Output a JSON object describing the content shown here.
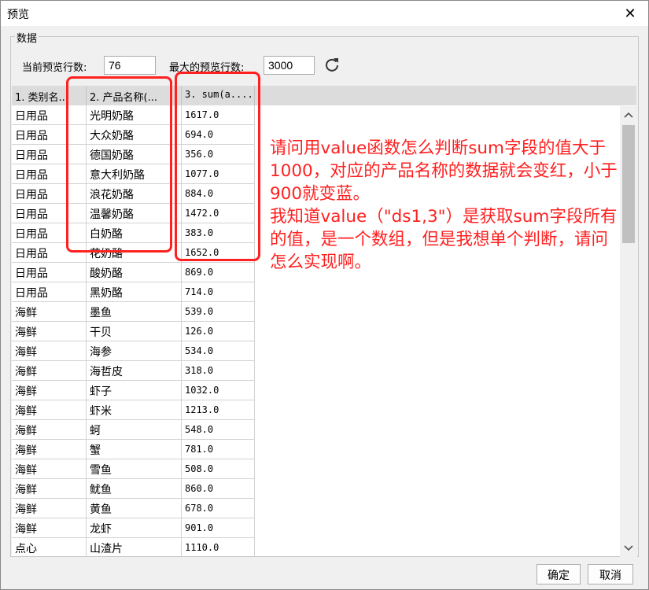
{
  "window": {
    "title": "预览",
    "close_label": "✕"
  },
  "group": {
    "legend": "数据"
  },
  "controls": {
    "current_rows_label": "当前预览行数:",
    "current_rows_value": "76",
    "max_rows_label": "最大的预览行数:",
    "max_rows_value": "3000",
    "refresh_icon": "refresh-icon"
  },
  "table": {
    "headers": [
      "1. 类别名...",
      "2. 产品名称(...",
      "3. sum(a...."
    ],
    "rows": [
      [
        "日用品",
        "光明奶酪",
        "1617.0"
      ],
      [
        "日用品",
        "大众奶酪",
        "694.0"
      ],
      [
        "日用品",
        "德国奶酪",
        "356.0"
      ],
      [
        "日用品",
        "意大利奶酪",
        "1077.0"
      ],
      [
        "日用品",
        "浪花奶酪",
        "884.0"
      ],
      [
        "日用品",
        "温馨奶酪",
        "1472.0"
      ],
      [
        "日用品",
        "白奶酪",
        "383.0"
      ],
      [
        "日用品",
        "花奶酪",
        "1652.0"
      ],
      [
        "日用品",
        "酸奶酪",
        "869.0"
      ],
      [
        "日用品",
        "黑奶酪",
        "714.0"
      ],
      [
        "海鲜",
        "墨鱼",
        "539.0"
      ],
      [
        "海鲜",
        "干贝",
        "126.0"
      ],
      [
        "海鲜",
        "海参",
        "534.0"
      ],
      [
        "海鲜",
        "海哲皮",
        "318.0"
      ],
      [
        "海鲜",
        "虾子",
        "1032.0"
      ],
      [
        "海鲜",
        "虾米",
        "1213.0"
      ],
      [
        "海鲜",
        "蚵",
        "548.0"
      ],
      [
        "海鲜",
        "蟹",
        "781.0"
      ],
      [
        "海鲜",
        "雪鱼",
        "508.0"
      ],
      [
        "海鲜",
        "鱿鱼",
        "860.0"
      ],
      [
        "海鲜",
        "黄鱼",
        "678.0"
      ],
      [
        "海鲜",
        "龙虾",
        "901.0"
      ],
      [
        "点心",
        "山渣片",
        "1110.0"
      ]
    ]
  },
  "annotation": {
    "paragraph1": "请问用value函数怎么判断sum字段的值大于1000，对应的产品名称的数据就会变红，小于900就变蓝。",
    "paragraph2": "我知道value（\"ds1,3\"）是获取sum字段所有的值，是一个数组，但是我想单个判断，请问怎么实现啊。",
    "color": "#ff2020"
  },
  "buttons": {
    "ok": "确定",
    "cancel": "取消"
  },
  "scrollbar": {
    "up_icon": "chevron-up-icon",
    "down_icon": "chevron-down-icon"
  }
}
